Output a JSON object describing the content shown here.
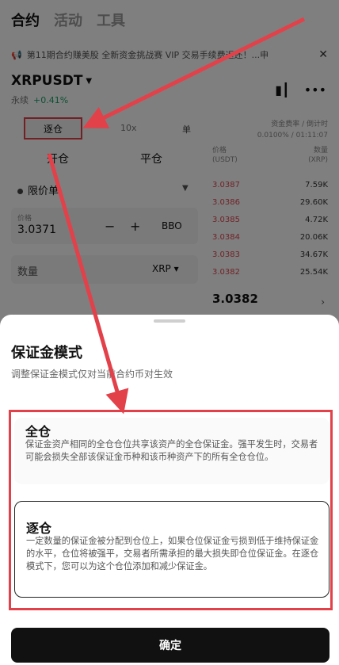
{
  "top_tabs": [
    "合约",
    "活动",
    "工具"
  ],
  "notice": {
    "text": "第11期合约赚美股 全新资金挑战赛 VIP 交易手续费返还！...申",
    "close": "✕"
  },
  "pair": {
    "symbol": "XRPUSDT",
    "sub_label": "永续",
    "change": "+0.41%"
  },
  "toolbar": {
    "margin_mode": "逐仓",
    "leverage": "10x",
    "single": "单"
  },
  "funding": {
    "label": "资金费率 / 倒计时",
    "value": "0.0100% / 01:11:07"
  },
  "trade_tabs": {
    "open": "开仓",
    "close": "平仓"
  },
  "orderbook": {
    "price_header": "价格\n(USDT)",
    "qty_header": "数量\n(XRP)",
    "asks": [
      {
        "price": "3.0387",
        "qty": "7.59K"
      },
      {
        "price": "3.0386",
        "qty": "29.60K"
      },
      {
        "price": "3.0385",
        "qty": "4.72K"
      },
      {
        "price": "3.0384",
        "qty": "20.06K"
      },
      {
        "price": "3.0383",
        "qty": "34.67K"
      },
      {
        "price": "3.0382",
        "qty": "25.54K"
      }
    ],
    "mid_price": "3.0382"
  },
  "order_type": "限价单",
  "price_field": {
    "label": "价格",
    "value": "3.0371",
    "minus": "−",
    "plus": "+",
    "bbo": "BBO"
  },
  "qty_field": {
    "label": "数量",
    "unit": "XRP"
  },
  "sheet": {
    "title": "保证金模式",
    "subtitle": "调整保证金模式仅对当前合约币对生效",
    "options": [
      {
        "title": "全仓",
        "desc": "保证金资产相同的全仓仓位共享该资产的全仓保证金。强平发生时，交易者可能会损失全部该保证金币种和该币种资产下的所有全仓仓位。"
      },
      {
        "title": "逐仓",
        "desc": "一定数量的保证金被分配到仓位上，如果仓位保证金亏损到低于维持保证金的水平，仓位将被强平，交易者所需承担的最大损失即仓位保证金。在逐仓模式下，您可以为这个仓位添加和减少保证金。"
      }
    ],
    "confirm": "确定"
  },
  "colors": {
    "annotation": "#e2414a",
    "ask": "#e0474f",
    "up": "#1aa36a"
  }
}
